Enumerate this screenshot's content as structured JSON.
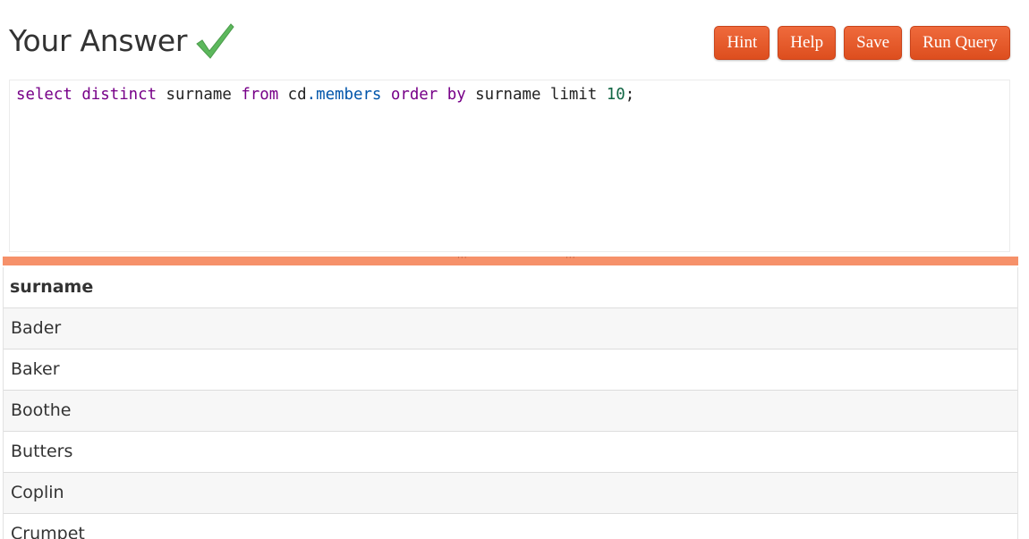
{
  "header": {
    "title": "Your Answer",
    "status_icon": "checkmark-icon",
    "status_color": "#5cb85c"
  },
  "toolbar": {
    "hint_label": "Hint",
    "help_label": "Help",
    "save_label": "Save",
    "run_label": "Run Query",
    "button_color": "#e5582a"
  },
  "editor": {
    "tokens": [
      {
        "text": "select",
        "cls": "kw"
      },
      {
        "text": " ",
        "cls": ""
      },
      {
        "text": "distinct",
        "cls": "kw"
      },
      {
        "text": " surname ",
        "cls": ""
      },
      {
        "text": "from",
        "cls": "kw"
      },
      {
        "text": " cd",
        "cls": ""
      },
      {
        "text": ".members",
        "cls": "prop"
      },
      {
        "text": " ",
        "cls": ""
      },
      {
        "text": "order",
        "cls": "kw"
      },
      {
        "text": " ",
        "cls": ""
      },
      {
        "text": "by",
        "cls": "kw"
      },
      {
        "text": " surname limit ",
        "cls": ""
      },
      {
        "text": "10",
        "cls": "num"
      },
      {
        "text": ";",
        "cls": ""
      }
    ]
  },
  "splitter": {
    "color": "#f6916a",
    "grip_glyph": "···"
  },
  "results": {
    "columns": [
      "surname"
    ],
    "rows": [
      [
        "Bader"
      ],
      [
        "Baker"
      ],
      [
        "Boothe"
      ],
      [
        "Butters"
      ],
      [
        "Coplin"
      ],
      [
        "Crumpet"
      ]
    ]
  }
}
